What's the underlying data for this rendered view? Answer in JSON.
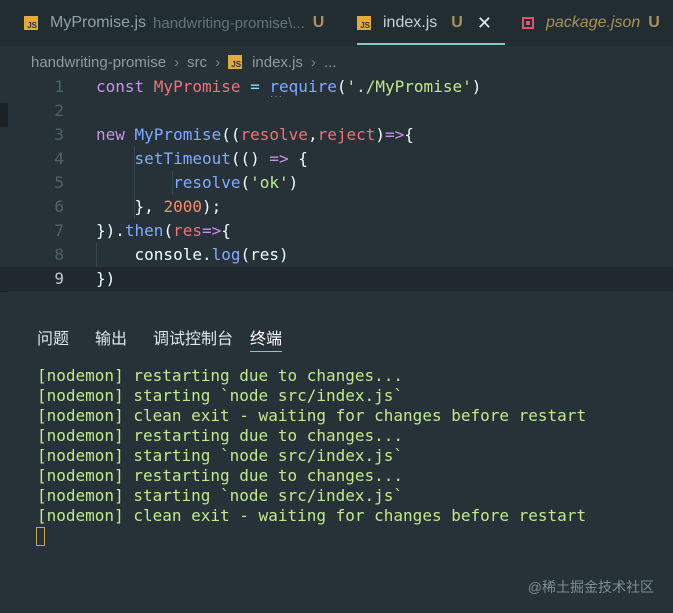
{
  "tabs": [
    {
      "name": "MyPromise.js",
      "description": "handwriting-promise\\...",
      "status": "U"
    },
    {
      "name": "index.js",
      "status": "U",
      "close": "✕"
    },
    {
      "name": "package.json",
      "status": "U"
    }
  ],
  "icons": {
    "js_icon_text": "JS"
  },
  "breadcrumb": {
    "items": [
      "handwriting-promise",
      "src",
      "index.js",
      "..."
    ],
    "separator": "›"
  },
  "editor": {
    "line_numbers": [
      "1",
      "2",
      "3",
      "4",
      "5",
      "6",
      "7",
      "8",
      "9"
    ],
    "active_line": 9,
    "lines": [
      [
        {
          "t": "const ",
          "c": "kw"
        },
        {
          "t": "MyPromise",
          "c": "cls"
        },
        {
          "t": " = ",
          "c": "op"
        },
        {
          "t": "require",
          "c": "fn"
        },
        {
          "t": "(",
          "c": "plain"
        },
        {
          "t": "'./MyPromise'",
          "c": "str"
        },
        {
          "t": ")",
          "c": "plain"
        }
      ],
      [],
      [
        {
          "t": "new ",
          "c": "kw"
        },
        {
          "t": "MyPromise",
          "c": "fn"
        },
        {
          "t": "((",
          "c": "plain"
        },
        {
          "t": "resolve",
          "c": "par"
        },
        {
          "t": ",",
          "c": "plain"
        },
        {
          "t": "reject",
          "c": "par"
        },
        {
          "t": ")",
          "c": "plain"
        },
        {
          "t": "=>",
          "c": "kw"
        },
        {
          "t": "{",
          "c": "plain"
        }
      ],
      [
        {
          "t": "    ",
          "c": "plain"
        },
        {
          "t": "setTimeout",
          "c": "fn"
        },
        {
          "t": "(() ",
          "c": "plain"
        },
        {
          "t": "=>",
          "c": "kw"
        },
        {
          "t": " {",
          "c": "plain"
        }
      ],
      [
        {
          "t": "        ",
          "c": "plain"
        },
        {
          "t": "resolve",
          "c": "fn"
        },
        {
          "t": "(",
          "c": "plain"
        },
        {
          "t": "'ok'",
          "c": "str"
        },
        {
          "t": ")",
          "c": "plain"
        }
      ],
      [
        {
          "t": "    }, ",
          "c": "plain"
        },
        {
          "t": "2000",
          "c": "num"
        },
        {
          "t": ");",
          "c": "plain"
        }
      ],
      [
        {
          "t": "}).",
          "c": "plain"
        },
        {
          "t": "then",
          "c": "fn"
        },
        {
          "t": "(",
          "c": "plain"
        },
        {
          "t": "res",
          "c": "par"
        },
        {
          "t": "=>",
          "c": "kw"
        },
        {
          "t": "{",
          "c": "plain"
        }
      ],
      [
        {
          "t": "    console.",
          "c": "plain"
        },
        {
          "t": "log",
          "c": "fn"
        },
        {
          "t": "(res)",
          "c": "plain"
        }
      ],
      [
        {
          "t": "})",
          "c": "plain"
        }
      ]
    ]
  },
  "panel": {
    "tabs": [
      "问题",
      "输出",
      "调试控制台",
      "终端"
    ],
    "active_tab": "终端"
  },
  "terminal": {
    "lines": [
      "[nodemon] restarting due to changes...",
      "[nodemon] starting `node src/index.js`",
      "[nodemon] clean exit - waiting for changes before restart",
      "[nodemon] restarting due to changes...",
      "[nodemon] starting `node src/index.js`",
      "[nodemon] restarting due to changes...",
      "[nodemon] starting `node src/index.js`",
      "[nodemon] clean exit - waiting for changes before restart"
    ]
  },
  "watermark": "@稀土掘金技术社区",
  "colors": {
    "background": "#263238",
    "tab_active_underline": "#80cbc4",
    "keyword": "#c792ea",
    "function": "#82aaff",
    "string": "#c3e88d",
    "number": "#f78c6c",
    "parameter": "#f07178",
    "modified": "#a7935a",
    "terminal_text": "#c3e88d"
  }
}
